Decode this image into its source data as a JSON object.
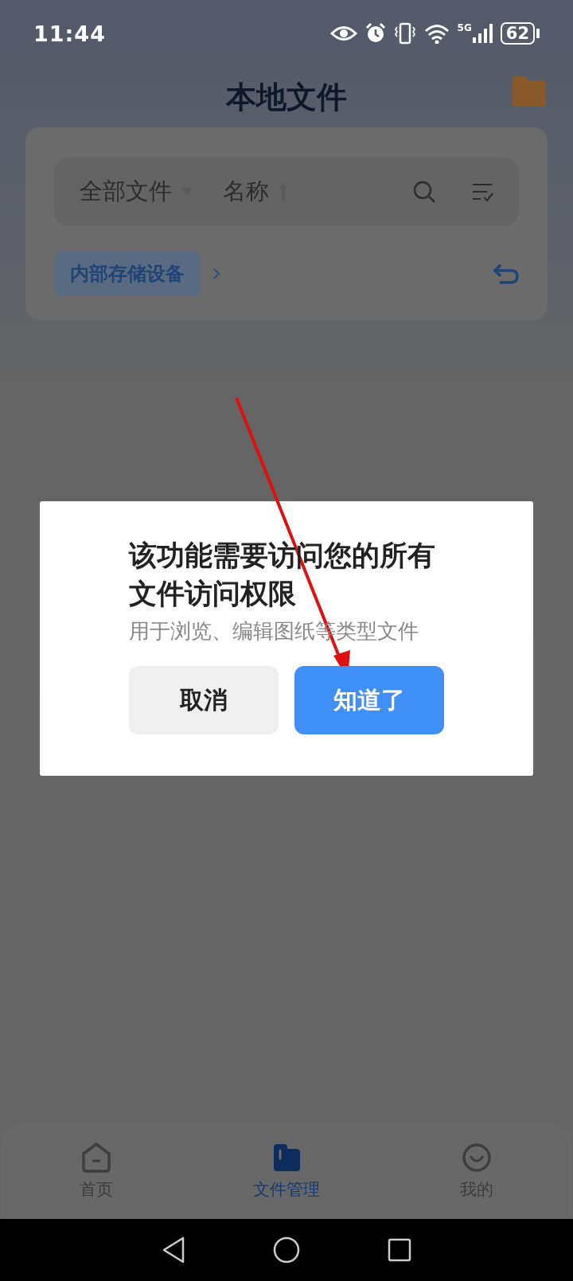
{
  "status_bar": {
    "time": "11:44",
    "network": "5G",
    "battery": "62"
  },
  "header": {
    "title": "本地文件"
  },
  "filter_bar": {
    "type_filter": "全部文件",
    "sort": "名称"
  },
  "breadcrumb": {
    "items": [
      "内部存储设备"
    ]
  },
  "dialog": {
    "title": "该功能需要访问您的所有文件访问权限",
    "message": "用于浏览、编辑图纸等类型文件",
    "buttons": [
      {
        "label": "取消",
        "kind": "secondary"
      },
      {
        "label": "知道了",
        "kind": "primary"
      }
    ]
  },
  "bottom_nav": [
    {
      "label": "首页",
      "kind": "home",
      "selected": false
    },
    {
      "label": "文件管理",
      "kind": "folder",
      "selected": true
    },
    {
      "label": "我的",
      "kind": "smile",
      "selected": false
    }
  ]
}
